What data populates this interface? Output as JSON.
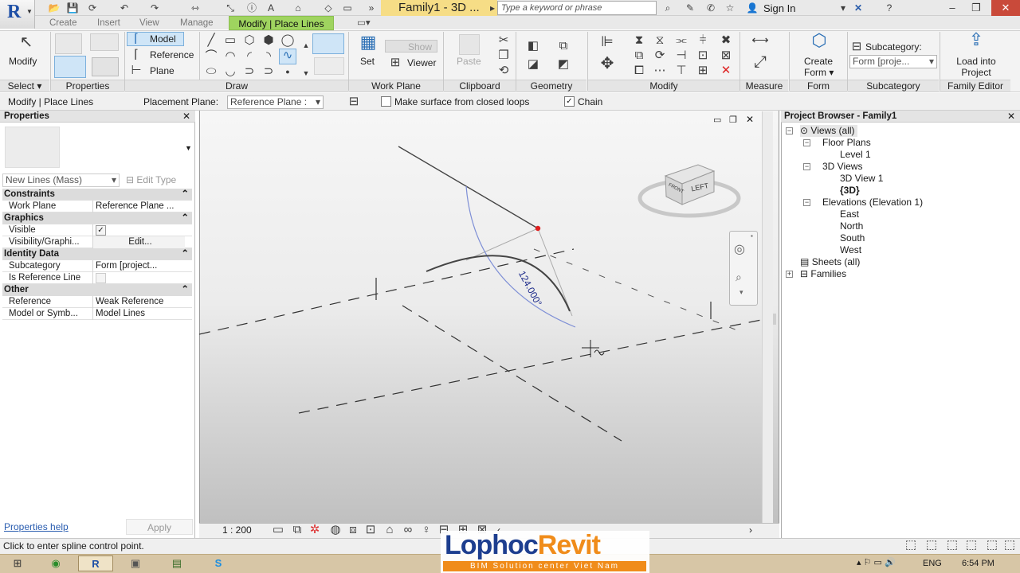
{
  "titlebar": {
    "document_title": "Family1 - 3D ...",
    "search_placeholder": "Type a keyword or phrase",
    "sign_in": "Sign In"
  },
  "tabs": [
    "Create",
    "Insert",
    "View",
    "Manage"
  ],
  "active_tab": "Modify | Place Lines",
  "ribbon": {
    "select": {
      "modify_label": "Modify",
      "title": "Select"
    },
    "properties": {
      "title": "Properties"
    },
    "draw": {
      "model": "Model",
      "reference": "Reference",
      "plane": "Plane",
      "title": "Draw"
    },
    "work_plane": {
      "set": "Set",
      "show": "Show",
      "viewer": "Viewer",
      "title": "Work Plane"
    },
    "clipboard": {
      "paste": "Paste",
      "title": "Clipboard"
    },
    "geometry": {
      "title": "Geometry"
    },
    "modify": {
      "title": "Modify"
    },
    "measure": {
      "title": "Measure"
    },
    "form": {
      "create_form_line1": "Create",
      "create_form_line2": "Form",
      "title": "Form"
    },
    "subcategory": {
      "label": "Subcategory:",
      "value": "Form [proje...",
      "title": "Subcategory"
    },
    "family_editor": {
      "load_line1": "Load into",
      "load_line2": "Project",
      "title": "Family Editor"
    }
  },
  "options_bar": {
    "context": "Modify | Place Lines",
    "placement_plane_label": "Placement Plane:",
    "placement_plane_value": "Reference Plane :",
    "make_surface_label": "Make surface from closed loops",
    "make_surface_checked": false,
    "chain_label": "Chain",
    "chain_checked": true
  },
  "properties_panel": {
    "title": "Properties",
    "type_selector": "New Lines (Mass)",
    "edit_type": "Edit Type",
    "sections": [
      {
        "name": "Constraints",
        "rows": [
          {
            "name": "Work Plane",
            "value": "Reference Plane ..."
          }
        ]
      },
      {
        "name": "Graphics",
        "rows": [
          {
            "name": "Visible",
            "value": "✓"
          },
          {
            "name": "Visibility/Graphi...",
            "value": "Edit..."
          }
        ]
      },
      {
        "name": "Identity Data",
        "rows": [
          {
            "name": "Subcategory",
            "value": "Form [project..."
          },
          {
            "name": "Is Reference Line",
            "value": ""
          }
        ]
      },
      {
        "name": "Other",
        "rows": [
          {
            "name": "Reference",
            "value": "Weak Reference"
          },
          {
            "name": "Model or Symb...",
            "value": "Model Lines"
          }
        ]
      }
    ],
    "help_link": "Properties help",
    "apply": "Apply"
  },
  "viewport": {
    "dimension_text": "124.000°",
    "viewcube_left": "LEFT",
    "viewcube_front": "FRONT",
    "scale": "1 : 200"
  },
  "project_browser": {
    "title": "Project Browser - Family1",
    "tree": {
      "root": "Views (all)",
      "floor_plans": "Floor Plans",
      "level_1": "Level 1",
      "views_3d": "3D Views",
      "view_3d_1": "3D View 1",
      "view_3d_current": "{3D}",
      "elevations": "Elevations (Elevation 1)",
      "east": "East",
      "north": "North",
      "south": "South",
      "west": "West",
      "sheets": "Sheets (all)",
      "families": "Families"
    }
  },
  "status_bar": {
    "message": "Click to enter spline control point."
  },
  "watermark": {
    "brand_part1": "Lophoc",
    "brand_part2": "Revit",
    "tagline": "BIM Solution center Viet Nam"
  },
  "taskbar": {
    "language": "ENG",
    "time": "6:54 PM"
  },
  "colors": {
    "active_tab": "#9fd45f",
    "title_highlight": "#f6dd86",
    "taskbar": "#d7c6a6",
    "brand_blue": "#1d3e8f",
    "brand_orange": "#f08c1a"
  }
}
